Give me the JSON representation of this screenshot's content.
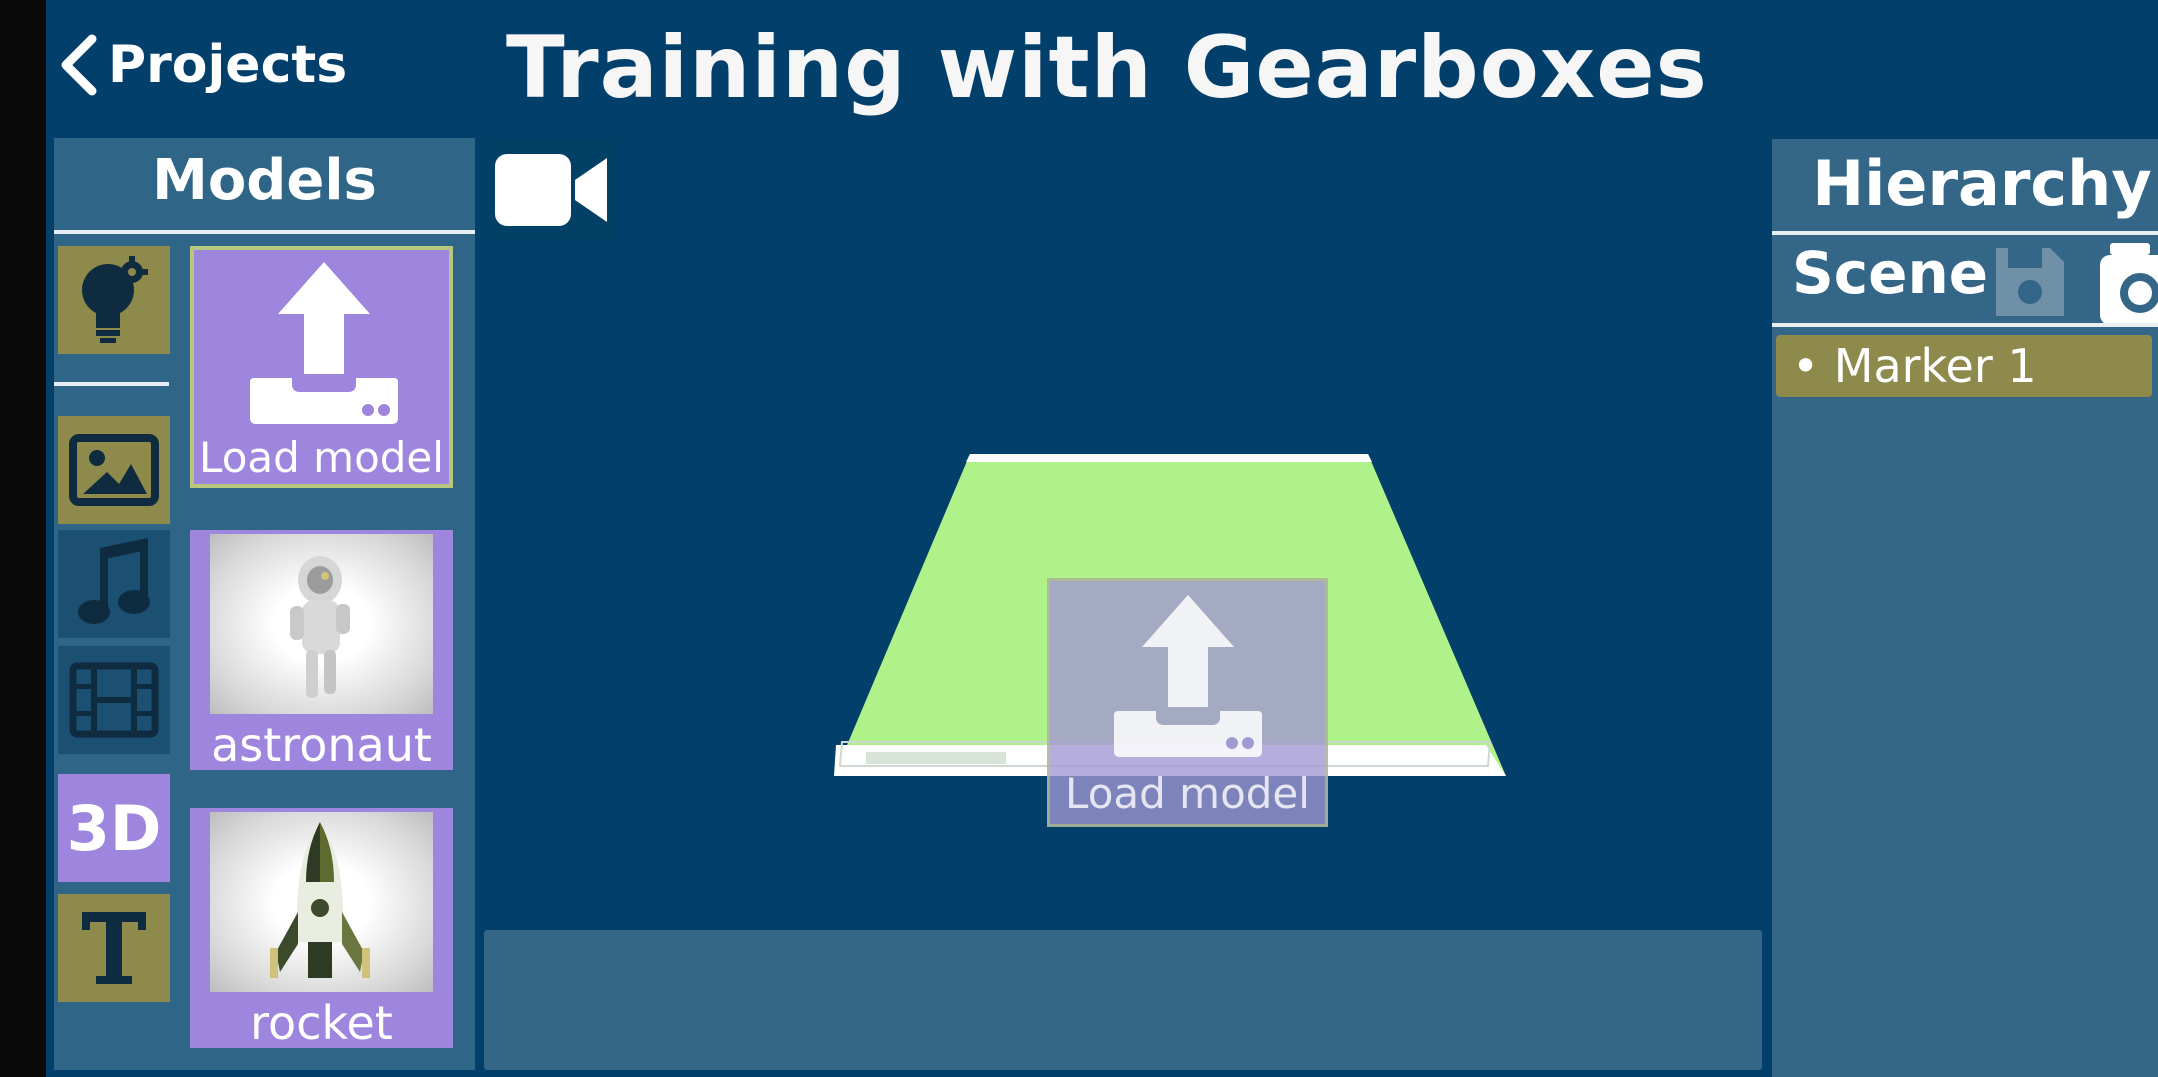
{
  "header": {
    "back_label": "Projects",
    "title": "Training with Gearboxes"
  },
  "models_panel": {
    "title": "Models",
    "categories": [
      {
        "name": "ideas",
        "icon": "lightbulb-gear-icon"
      },
      {
        "name": "images",
        "icon": "image-icon"
      },
      {
        "name": "audio",
        "icon": "music-note-icon"
      },
      {
        "name": "video",
        "icon": "film-strip-icon"
      },
      {
        "name": "3d",
        "label": "3D",
        "selected": true
      },
      {
        "name": "text",
        "icon": "text-t-icon"
      }
    ],
    "tiles": [
      {
        "label": "Load model",
        "icon": "upload-icon",
        "selected": true
      },
      {
        "label": "astronaut",
        "thumbnail": "astronaut"
      },
      {
        "label": "rocket",
        "thumbnail": "rocket"
      }
    ]
  },
  "viewport": {
    "camera_icon": "video-camera-icon",
    "ghost_tile_label": "Load model",
    "marker_color": "#b0f28a"
  },
  "hierarchy": {
    "title": "Hierarchy",
    "scene_label": "Scene",
    "save_icon": "save-icon",
    "camera_icon": "camera-icon",
    "items": [
      {
        "label": "• Marker 1",
        "selected": true
      }
    ]
  },
  "colors": {
    "background": "#02406b",
    "panel": "#336687",
    "olive": "#8d8a4b",
    "purple": "#9e86de"
  }
}
